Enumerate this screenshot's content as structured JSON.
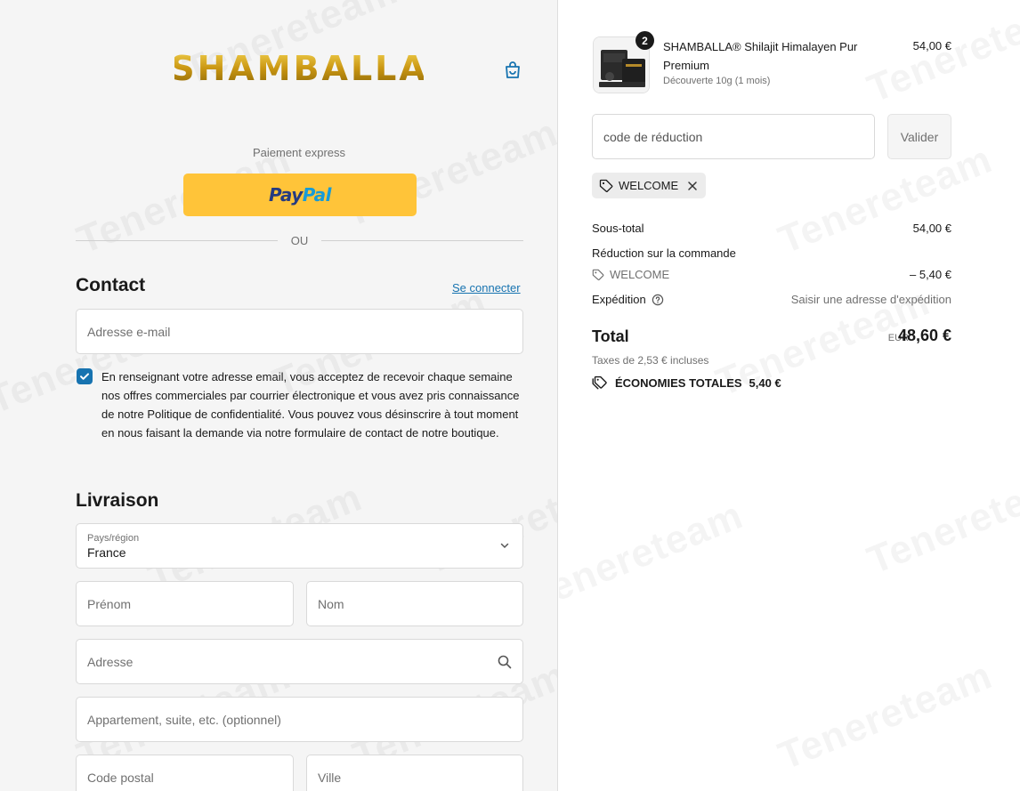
{
  "brand": {
    "logo_text": "SHAMBALLA",
    "accent": "#1773b0",
    "paypal_yellow": "#ffc439",
    "logo_gold": "#d4a017"
  },
  "watermark": "Tenereteam",
  "express": {
    "label": "Paiement express",
    "paypal_part1": "Pay",
    "paypal_part2": "Pal",
    "or_text": "OU"
  },
  "contact": {
    "title": "Contact",
    "login_link": "Se connecter",
    "email_placeholder": "Adresse e-mail",
    "consent_checked": true,
    "consent_text": "En renseignant votre adresse email, vous acceptez de recevoir chaque semaine nos offres commerciales par courrier électronique et vous avez pris connaissance de notre Politique de confidentialité. Vous pouvez vous désinscrire à tout moment en nous faisant la demande via notre formulaire de contact de notre boutique."
  },
  "delivery": {
    "title": "Livraison",
    "country_label": "Pays/région",
    "country_value": "France",
    "first_name_placeholder": "Prénom",
    "last_name_placeholder": "Nom",
    "address_placeholder": "Adresse",
    "apartment_placeholder": "Appartement, suite, etc. (optionnel)",
    "postal_placeholder": "Code postal",
    "city_placeholder": "Ville"
  },
  "order": {
    "product": {
      "quantity": "2",
      "name": "SHAMBALLA® Shilajit Himalayen Pur Premium",
      "variant": "Découverte 10g (1 mois)",
      "price": "54,00 €"
    },
    "discount_placeholder": "code de réduction",
    "validate_label": "Valider",
    "applied_code": "WELCOME",
    "subtotal_label": "Sous-total",
    "subtotal_value": "54,00 €",
    "order_discount_label": "Réduction sur la commande",
    "discount_code": "WELCOME",
    "discount_value": "– 5,40 €",
    "shipping_label": "Expédition",
    "shipping_value": "Saisir une adresse d'expédition",
    "total_label": "Total",
    "currency": "EUR",
    "total_value": "48,60 €",
    "tax_text": "Taxes de 2,53 € incluses",
    "savings_label": "ÉCONOMIES TOTALES",
    "savings_value": "5,40 €"
  }
}
